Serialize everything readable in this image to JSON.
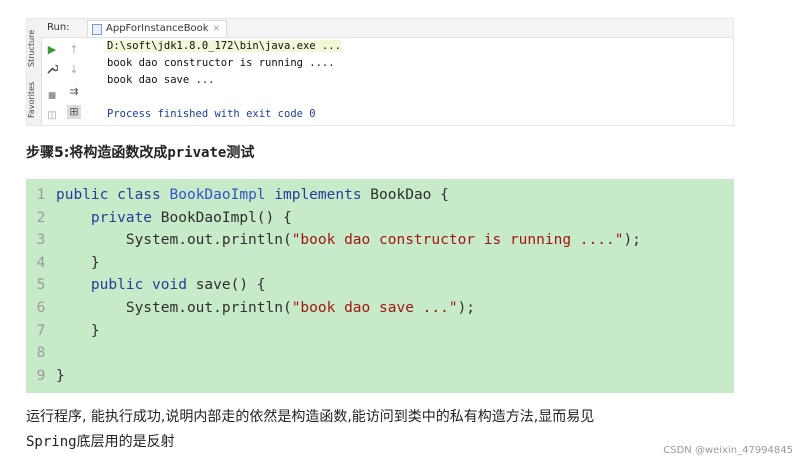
{
  "ide": {
    "run_label": "Run:",
    "run_tab": "AppForInstanceBook",
    "tab_close": "×",
    "side_tabs": [
      "Structure",
      "Favorites"
    ],
    "console_lines": [
      "D:\\soft\\jdk1.8.0_172\\bin\\java.exe ...",
      "book dao constructor is running ....",
      "book dao save ...",
      "Process finished with exit code 0"
    ],
    "tool_icons": {
      "run": "▶",
      "up": "↑",
      "wrench": "🔧",
      "down": "↓",
      "stop": "■",
      "wrap": "⇉",
      "camera": "◫",
      "scroll": "⊞"
    }
  },
  "step": {
    "title_prefix": "步骤5:将构造函数改成",
    "title_mono": "private",
    "title_suffix": "测试"
  },
  "code": {
    "lines": [
      {
        "n": "1",
        "tokens": [
          [
            "kw",
            "public class "
          ],
          [
            "class",
            "BookDaoImpl"
          ],
          [
            "kw",
            " implements "
          ],
          [
            "plain",
            "BookDao {"
          ]
        ]
      },
      {
        "n": "2",
        "tokens": [
          [
            "plain",
            "    "
          ],
          [
            "kw",
            "private "
          ],
          [
            "plain",
            "BookDaoImpl() {"
          ]
        ]
      },
      {
        "n": "3",
        "tokens": [
          [
            "plain",
            "        System.out.println("
          ],
          [
            "str",
            "\"book dao constructor is running ....\""
          ],
          [
            "plain",
            ");"
          ]
        ]
      },
      {
        "n": "4",
        "tokens": [
          [
            "plain",
            "    }"
          ]
        ]
      },
      {
        "n": "5",
        "tokens": [
          [
            "plain",
            "    "
          ],
          [
            "kw",
            "public void "
          ],
          [
            "plain",
            "save() {"
          ]
        ]
      },
      {
        "n": "6",
        "tokens": [
          [
            "plain",
            "        System.out.println("
          ],
          [
            "str",
            "\"book dao save ...\""
          ],
          [
            "plain",
            ");"
          ]
        ]
      },
      {
        "n": "7",
        "tokens": [
          [
            "plain",
            "    }"
          ]
        ]
      },
      {
        "n": "8",
        "tokens": []
      },
      {
        "n": "9",
        "tokens": [
          [
            "plain",
            "}"
          ]
        ]
      }
    ]
  },
  "paragraph": {
    "line1": "运行程序, 能执行成功,说明内部走的依然是构造函数,能访问到类中的私有构造方法,显而易见",
    "line2_mono": "Spring",
    "line2_rest": "底层用的是反射"
  },
  "watermark": "CSDN @weixin_47994845",
  "colors": {
    "code_bg": "#c7ebc9",
    "keyword": "#2b3a9a",
    "class_name": "#3652c8",
    "string": "#a31515",
    "console_exit": "#1a3ea0"
  }
}
